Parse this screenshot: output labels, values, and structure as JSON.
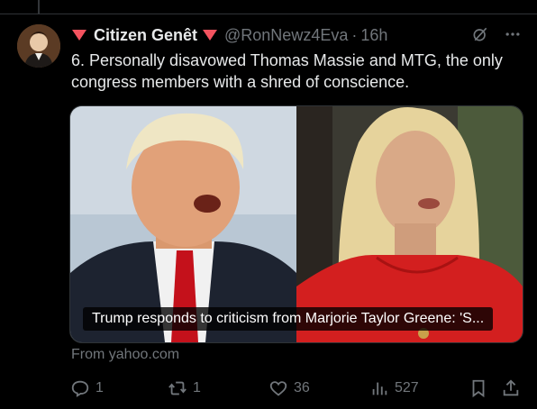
{
  "post": {
    "author_name": "Citizen Genêt",
    "handle": "@RonNewz4Eva",
    "separator": "·",
    "time": "16h",
    "text": "6. Personally disavowed  Thomas Massie and MTG, the only congress members with a shred of conscience.",
    "media_caption": "Trump responds to criticism from Marjorie Taylor Greene: 'S...",
    "source": "From yahoo.com",
    "stats": {
      "replies": "1",
      "reposts": "1",
      "likes": "36",
      "views": "527"
    }
  },
  "icons": {
    "header_badge": "red-triangle-icon",
    "grok": "grok-icon",
    "more": "more-icon",
    "reply": "reply-icon",
    "repost": "repost-icon",
    "like": "like-icon",
    "views": "views-icon",
    "bookmark": "bookmark-icon",
    "share": "share-icon"
  },
  "colors": {
    "background": "#000000",
    "text": "#e7e9ea",
    "muted": "#71767b",
    "badge_red": "#f4535f"
  }
}
